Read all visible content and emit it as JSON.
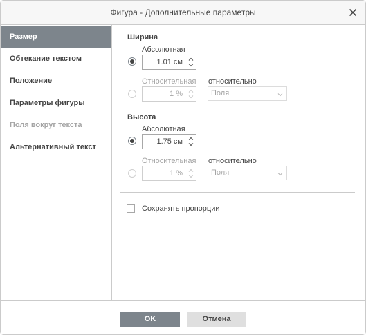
{
  "window": {
    "title": "Фигура - Дополнительные параметры"
  },
  "sidebar": {
    "items": [
      {
        "label": "Размер",
        "state": "active"
      },
      {
        "label": "Обтекание текстом",
        "state": "normal"
      },
      {
        "label": "Положение",
        "state": "normal"
      },
      {
        "label": "Параметры фигуры",
        "state": "normal"
      },
      {
        "label": "Поля вокруг текста",
        "state": "disabled"
      },
      {
        "label": "Альтернативный текст",
        "state": "normal"
      }
    ]
  },
  "width": {
    "heading": "Ширина",
    "absolute_label": "Абсолютная",
    "absolute_value": "1.01 см",
    "relative_label": "Относительная",
    "relative_value": "1 %",
    "relative_to_label": "относительно",
    "relative_to_value": "Поля",
    "selected": "absolute"
  },
  "height": {
    "heading": "Высота",
    "absolute_label": "Абсолютная",
    "absolute_value": "1.75 см",
    "relative_label": "Относительная",
    "relative_value": "1 %",
    "relative_to_label": "относительно",
    "relative_to_value": "Поля",
    "selected": "absolute"
  },
  "keep_proportions": {
    "label": "Сохранять пропорции",
    "checked": false
  },
  "footer": {
    "ok_label": "OK",
    "cancel_label": "Отмена"
  },
  "colors": {
    "accent": "#7d858c",
    "border": "#cbcbcb",
    "text": "#444444",
    "disabled_text": "#a5a5a5"
  }
}
